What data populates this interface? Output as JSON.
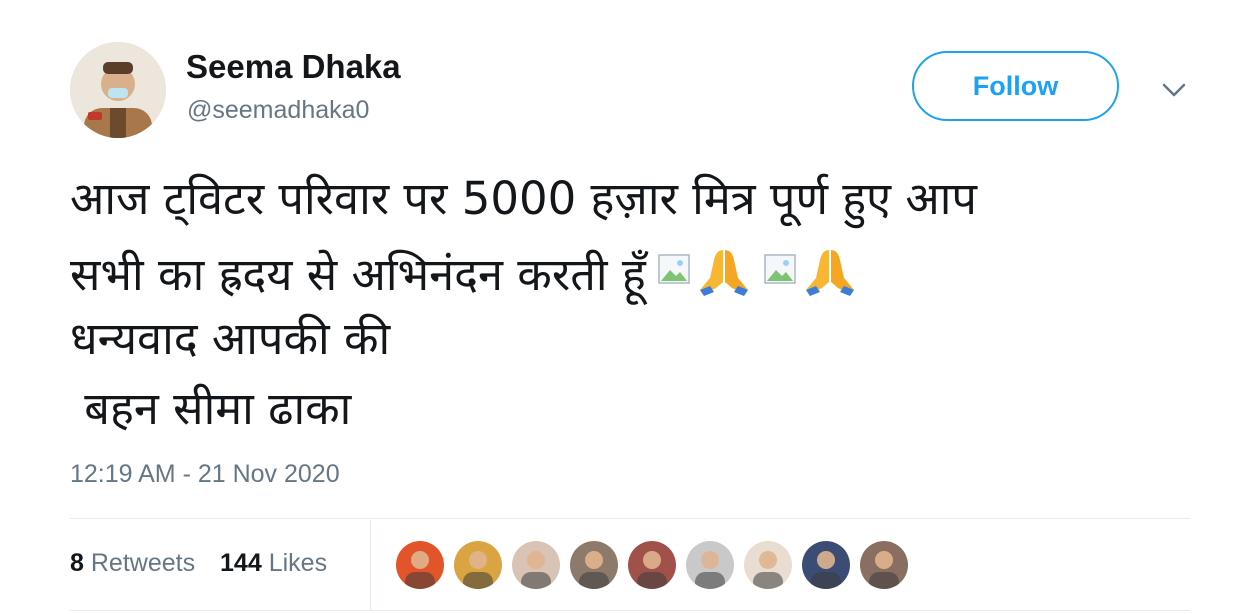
{
  "author": {
    "name": "Seema Dhaka",
    "handle": "@seemadhaka0",
    "avatar_icon": "user-avatar"
  },
  "follow_button": {
    "label": "Follow"
  },
  "tweet": {
    "lines": [
      "आज ट्विटर परिवार पर 5000 हज़ार मित्र पूर्ण हुए आप",
      "सभी का ह्रदय से अभिनंदन करती हूँ",
      "धन्यवाद आपकी की",
      " बहन सीमा ढाका"
    ],
    "emojis": [
      "broken-image-icon",
      "folded-hands-emoji",
      "broken-image-icon",
      "folded-hands-emoji"
    ]
  },
  "timestamp": "12:19 AM - 21 Nov 2020",
  "stats": {
    "retweets_count": "8",
    "retweets_label": "Retweets",
    "likes_count": "144",
    "likes_label": "Likes"
  },
  "likers": [
    {
      "icon": "liker-avatar",
      "color": "#e2542a"
    },
    {
      "icon": "liker-avatar",
      "color": "#d9a441"
    },
    {
      "icon": "liker-avatar",
      "color": "#d8c3b4"
    },
    {
      "icon": "liker-avatar",
      "color": "#8d7a6a"
    },
    {
      "icon": "liker-avatar",
      "color": "#a0524a"
    },
    {
      "icon": "liker-avatar",
      "color": "#c9c9c9"
    },
    {
      "icon": "liker-avatar",
      "color": "#e9ddd1"
    },
    {
      "icon": "liker-avatar",
      "color": "#3b4d74"
    },
    {
      "icon": "liker-avatar",
      "color": "#8a6e62"
    }
  ],
  "colors": {
    "accent": "#1da1f2",
    "secondary_text": "#657786",
    "divider": "#e6ecf0"
  }
}
